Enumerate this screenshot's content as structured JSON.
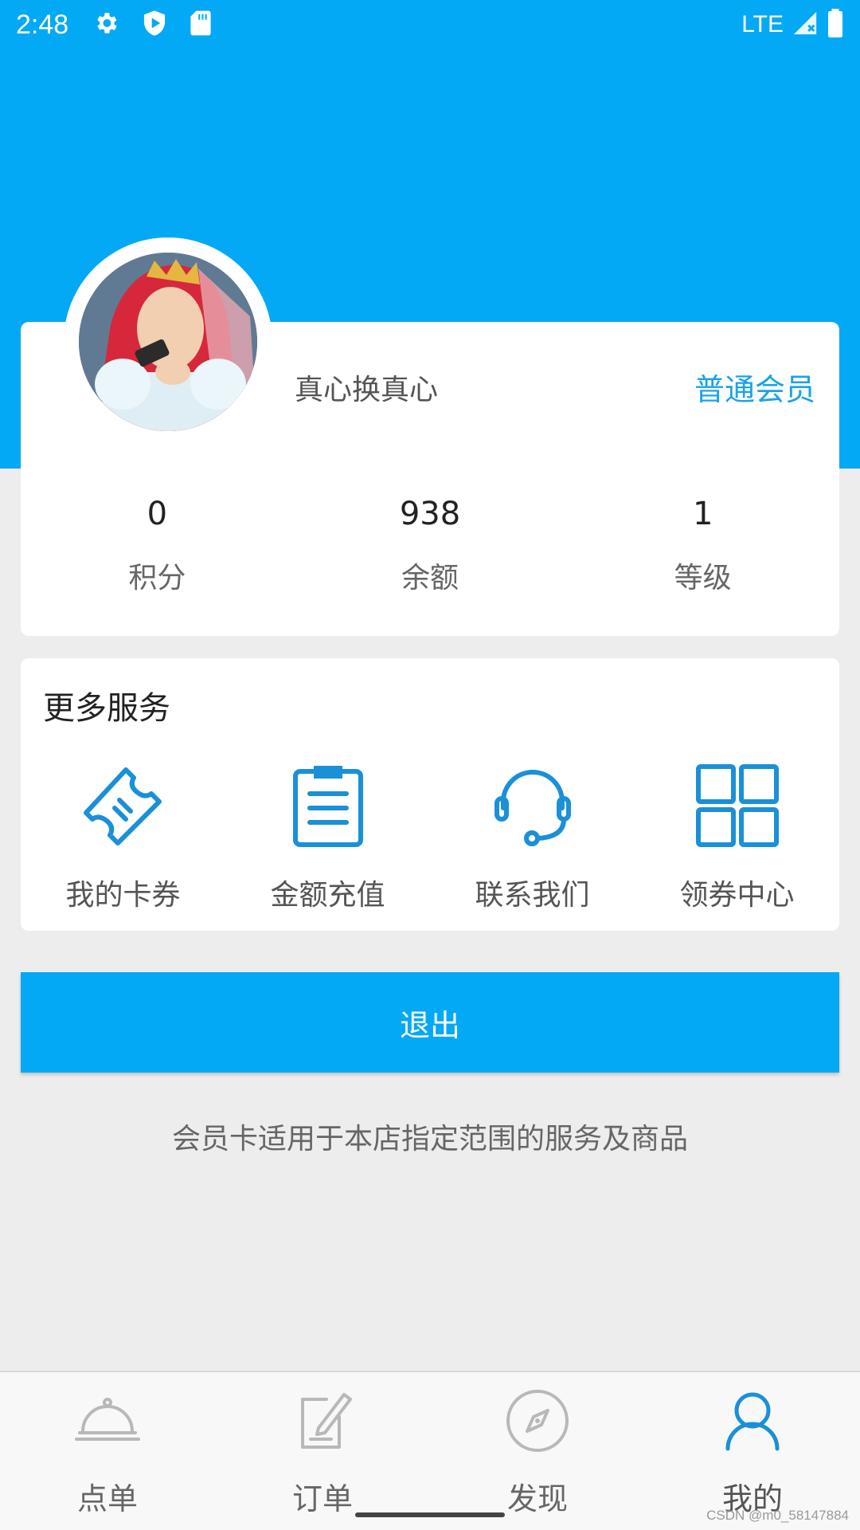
{
  "status_bar": {
    "time": "2:48",
    "network": "LTE",
    "left_icons": [
      "gear-icon",
      "shield-play-icon",
      "sd-card-icon"
    ],
    "right_icons": [
      "signal-icon",
      "battery-icon"
    ]
  },
  "colors": {
    "primary": "#03a9f4",
    "link": "#1aa3e8",
    "icon": "#1a90d8",
    "background": "#ededed"
  },
  "profile": {
    "nickname": "真心换真心",
    "member_level": "普通会员",
    "stats": [
      {
        "value": "0",
        "label": "积分"
      },
      {
        "value": "938",
        "label": "余额"
      },
      {
        "value": "1",
        "label": "等级"
      }
    ]
  },
  "services": {
    "title": "更多服务",
    "items": [
      {
        "label": "我的卡券",
        "icon": "ticket-icon"
      },
      {
        "label": "金额充值",
        "icon": "clipboard-icon"
      },
      {
        "label": "联系我们",
        "icon": "headset-icon"
      },
      {
        "label": "领券中心",
        "icon": "grid-icon"
      }
    ]
  },
  "logout_label": "退出",
  "footer_note": "会员卡适用于本店指定范围的服务及商品",
  "tabs": [
    {
      "label": "点单",
      "icon": "dish-cover-icon"
    },
    {
      "label": "订单",
      "icon": "edit-note-icon"
    },
    {
      "label": "发现",
      "icon": "compass-icon"
    },
    {
      "label": "我的",
      "icon": "user-icon",
      "active": true
    }
  ],
  "watermark": "CSDN @m0_58147884"
}
